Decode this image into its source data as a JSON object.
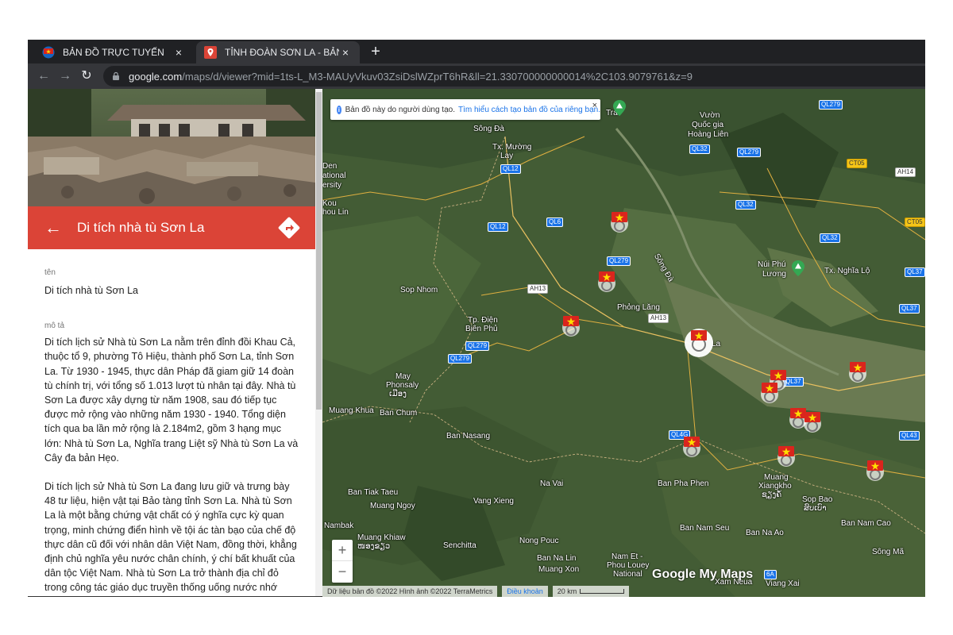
{
  "browser": {
    "tabs": [
      {
        "title": "BẢN ĐỒ TRỰC TUYẾN",
        "close": "×",
        "active": false
      },
      {
        "title": "TỈNH ĐOÀN SƠN LA - BẢN ĐỒ T",
        "close": "×",
        "active": true
      }
    ],
    "new_tab": "+",
    "back": "←",
    "forward": "→",
    "reload": "↻",
    "url_host": "google.com",
    "url_rest": "/maps/d/viewer?mid=1ts-L_M3-MAUyVkuv03ZsiDslWZprT6hR&ll=21.330700000000014%2C103.9079761&z=9"
  },
  "panel": {
    "back": "←",
    "title": "Di tích nhà tù Sơn La",
    "name_label": "tên",
    "name_value": "Di tích nhà tù Sơn La",
    "desc_label": "mô tả",
    "desc_p1": "Di tích lịch sử Nhà tù Sơn La nằm trên đỉnh đồi Khau Cả, thuộc tổ 9, phường Tô Hiệu, thành phố Sơn La, tỉnh Sơn La. Từ 1930 - 1945, thực dân Pháp đã giam giữ 14 đoàn tù chính trị, với tổng số 1.013 lượt tù nhân tại đây. Nhà tù Sơn La được xây dựng từ năm 1908, sau đó tiếp tục được mở rộng vào những năm 1930 - 1940. Tổng diện tích qua ba lần mở rộng là 2.184m2, gồm 3 hạng mục lớn: Nhà tù Sơn La, Nghĩa trang Liệt sỹ Nhà tù Sơn La và Cây đa bản Hẹo.",
    "desc_p2": "Di tích lịch sử Nhà tù Sơn La đang lưu giữ và trưng bày 48 tư liệu, hiện vật tại Bảo tàng tỉnh Sơn La. Nhà tù Sơn La là một bằng chứng vật chất có ý nghĩa cực kỳ quan trọng, minh chứng điển hình về tội ác tàn bạo của chế độ thực dân cũ đối với nhân dân Việt Nam, đồng thời, khẳng định chủ nghĩa yêu nước chân chính, ý chí bất khuất của dân tộc Việt Nam. Nhà tù Sơn La trở thành địa chỉ đỏ trong công tác giáo dục truyền thống uống nước nhớ nguồn, tinh thần yêu nước cho nhân dân, thu hút đông đảo du khách trong và ngoài nước đến tham quan, học tập và nghiên cứu..."
  },
  "map": {
    "banner_text": "Bản đồ này do người dùng tạo.",
    "banner_link": "Tìm hiểu cách tạo bản đồ của riêng bạn.",
    "banner_close": "×",
    "zoom_in": "+",
    "zoom_out": "−",
    "logo": "Google My Maps",
    "attribution": "Dữ liệu bản đồ ©2022 Hình ảnh ©2022 TerraMetrics",
    "terms": "Điều khoản",
    "scale": "20 km",
    "places": {
      "tra": "Tra",
      "vuon": "Vườn",
      "quoc_gia": "Quốc gia",
      "hoang_lien": "Hoàng Liên",
      "song_da_1": "Sông Đà",
      "tx_muong_lay_1": "Tx. Mường",
      "tx_muong_lay_2": "Lay",
      "den_1": "Den",
      "den_2": "ational",
      "den_3": "ersity",
      "kou_1": "Kou",
      "kou_2": "hou Lin",
      "song_da_2": "Sông Đà",
      "nui_phu_luong_1": "Núi Phú",
      "nui_phu_luong_2": "Lương",
      "tx_nghia_lo": "Tx. Nghĩa Lộ",
      "sop_nhom": "Sop Nhom",
      "phong_lang": "Phỏng Lăng",
      "tp_dien_bien_1": "Tp. Điện",
      "tp_dien_bien_2": "Biên Phủ",
      "son_la": "La",
      "may_1": "May",
      "may_2": "Phonsaly",
      "may_3": "ເມືອງ",
      "muang_khua": "Muang Khua",
      "ban_chum": "Ban Chum",
      "ban_nasang": "Ban Nasang",
      "na_vai": "Na Vai",
      "ban_pha_phen": "Ban Pha Phen",
      "muang_xiangkho_1": "Muang",
      "muang_xiangkho_2": "Xiangkho",
      "muang_xiangkho_3": "ຊຽງຄໍ້",
      "sop_bao_1": "Sop Bao",
      "sop_bao_2": "ສົບເບົາ",
      "ban_tiak_taeu": "Ban Tiak Taeu",
      "vang_xieng": "Vang Xieng",
      "muang_ngoy": "Muang Ngoy",
      "nambak": "Nambak",
      "ban_nam_seu": "Ban Nam Seu",
      "ban_na_ao": "Ban Na Ao",
      "ban_nam_cao": "Ban Nam Cao",
      "muang_khiaw_1": "Muang Khiaw",
      "muang_khiaw_2": "ໜອງຂຽວ",
      "senchitta": "Senchitta",
      "nong_pouc": "Nong Pouc",
      "ban_na_lin": "Ban Na Lin",
      "nam_et_1": "Nam Et -",
      "nam_et_2": "Phou Louey",
      "nam_et_3": "National",
      "muang_xon": "Muang Xon",
      "song_ma": "Sông Mã",
      "xam_neua": "Xam Neua",
      "viang_xai": "Viang Xai"
    },
    "roads": {
      "ql279_a": "QL279",
      "ql32_a": "QL32",
      "ql279_b": "QL279",
      "ct05_a": "CT05",
      "ah14": "AH14",
      "ql12_a": "QL12",
      "ql32_b": "QL32",
      "ql6": "QL6",
      "ql12_b": "QL12",
      "ct05_b": "CT05",
      "ql32_c": "QL32",
      "ql279_c": "QL279",
      "ql37_a": "QL37",
      "ah13_a": "AH13",
      "ah13_b": "AH13",
      "ql37_b": "QL37",
      "ql279_d": "QL279",
      "ql279_e": "QL279",
      "ql37_c": "QL37",
      "ql4g": "QL4G",
      "ql43": "QL43",
      "r6a": "6A"
    }
  }
}
